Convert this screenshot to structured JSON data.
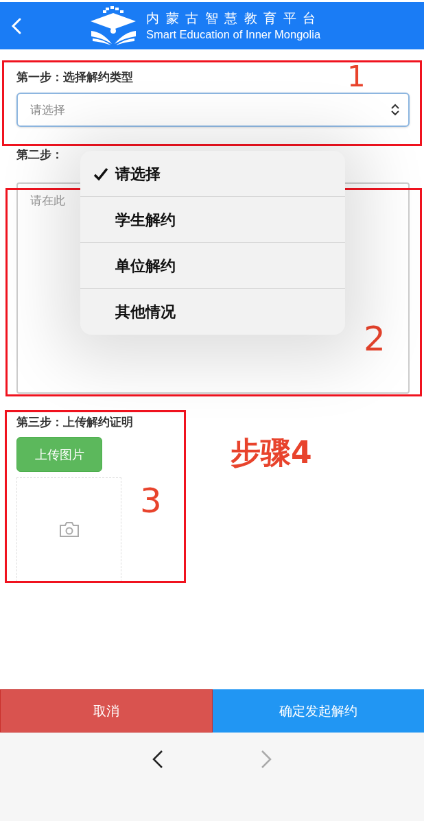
{
  "header": {
    "title": "内蒙古智慧教育平台",
    "subtitle": "Smart Education of Inner Mongolia"
  },
  "steps": [
    {
      "kind": "select",
      "label": "第一步：选择解约类型",
      "placeholder": "请选择",
      "annotation": "1"
    },
    {
      "kind": "textarea",
      "label": "第二步：",
      "placeholder": "请在此",
      "annotation": "2"
    },
    {
      "kind": "upload",
      "label": "第三步：上传解约证明",
      "button": "上传图片",
      "annotation": "3",
      "note": "步骤4"
    }
  ],
  "picker": {
    "options": [
      {
        "label": "请选择",
        "selected": true
      },
      {
        "label": "学生解约",
        "selected": false
      },
      {
        "label": "单位解约",
        "selected": false
      },
      {
        "label": "其他情况",
        "selected": false
      }
    ]
  },
  "actions": [
    {
      "kind": "cancel",
      "label": "取消"
    },
    {
      "kind": "confirm",
      "label": "确定发起解约"
    }
  ],
  "nav": [
    {
      "kind": "back",
      "disabled": false
    },
    {
      "kind": "forward",
      "disabled": true
    }
  ]
}
